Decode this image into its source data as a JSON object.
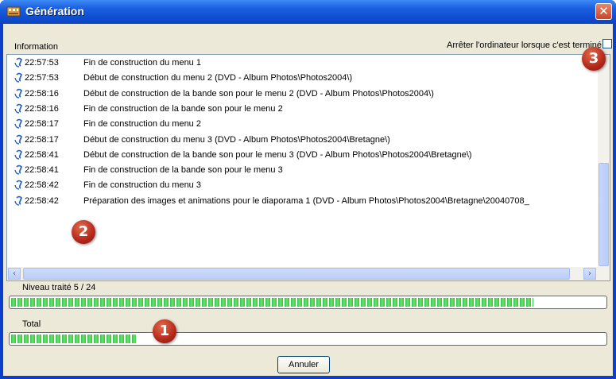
{
  "window": {
    "title": "Génération"
  },
  "header": {
    "column_label": "Information",
    "stop_label": "Arrêter l'ordinateur lorsque c'est terminé",
    "stop_checked": false
  },
  "log": [
    {
      "time": "22:57:53",
      "message": "Fin de construction du menu 1"
    },
    {
      "time": "22:57:53",
      "message": "Début de construction du menu 2 (DVD - Album Photos\\Photos2004\\)"
    },
    {
      "time": "22:58:16",
      "message": "Début de construction de la bande son pour le menu 2 (DVD - Album Photos\\Photos2004\\)"
    },
    {
      "time": "22:58:16",
      "message": "Fin de construction de la bande son pour le menu 2"
    },
    {
      "time": "22:58:17",
      "message": "Fin de construction du menu 2"
    },
    {
      "time": "22:58:17",
      "message": "Début de construction du menu 3 (DVD - Album Photos\\Photos2004\\Bretagne\\)"
    },
    {
      "time": "22:58:41",
      "message": "Début de construction de la bande son pour le menu 3 (DVD - Album Photos\\Photos2004\\Bretagne\\)"
    },
    {
      "time": "22:58:41",
      "message": "Fin de construction de la bande son pour le menu 3"
    },
    {
      "time": "22:58:42",
      "message": "Fin de construction du menu 3"
    },
    {
      "time": "22:58:42",
      "message": "Préparation des images et animations pour le diaporama 1 (DVD - Album Photos\\Photos2004\\Bretagne\\20040708_"
    }
  ],
  "progress": {
    "level_label": "Niveau traité 5 / 24",
    "level_fraction": 0.88,
    "total_label": "Total",
    "total_fraction": 0.21
  },
  "buttons": {
    "cancel": "Annuler"
  },
  "markers": {
    "one": "1",
    "two": "2",
    "three": "3"
  },
  "icons": {
    "log_entry": "info-icon",
    "title": "film-icon",
    "close": "close-icon"
  }
}
